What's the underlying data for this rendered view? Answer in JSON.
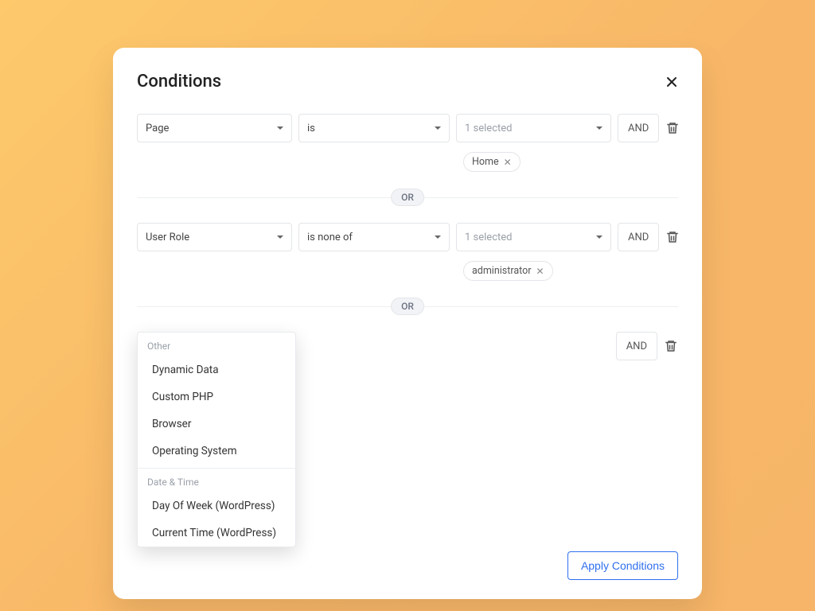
{
  "modal": {
    "title": "Conditions",
    "apply": "Apply Conditions"
  },
  "labels": {
    "and": "AND",
    "or": "OR"
  },
  "rows": [
    {
      "field": "Page",
      "operator": "is",
      "valuePlaceholder": "1 selected",
      "chips": [
        "Home"
      ]
    },
    {
      "field": "User Role",
      "operator": "is none of",
      "valuePlaceholder": "1 selected",
      "chips": [
        "administrator"
      ]
    }
  ],
  "dropdown": {
    "groups": [
      {
        "label": "Other",
        "items": [
          "Dynamic Data",
          "Custom PHP",
          "Browser",
          "Operating System"
        ]
      },
      {
        "label": "Date & Time",
        "items": [
          "Day Of Week (WordPress)",
          "Current Time (WordPress)"
        ]
      }
    ]
  }
}
